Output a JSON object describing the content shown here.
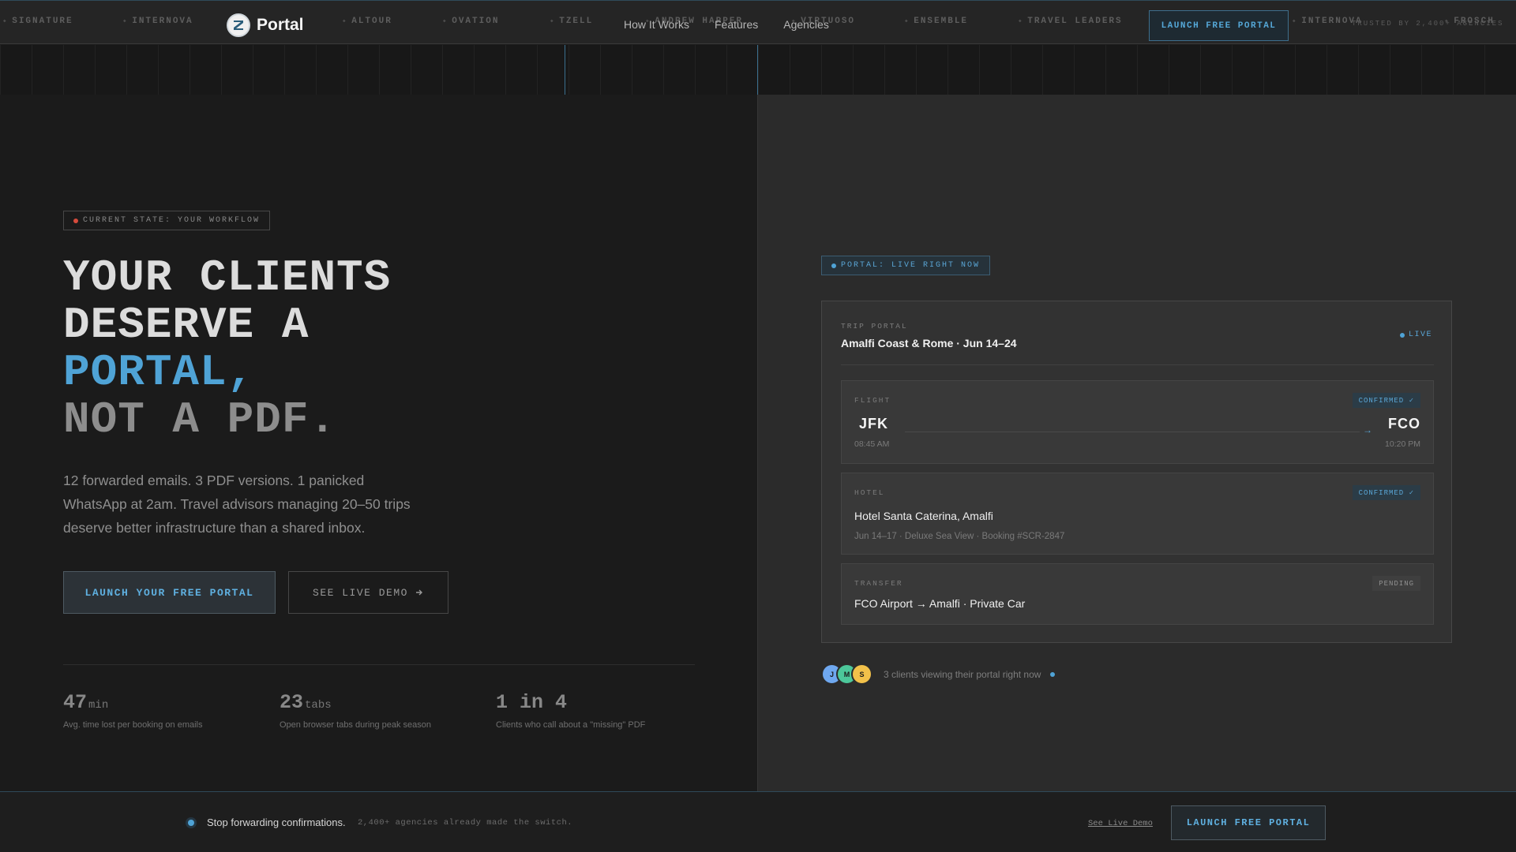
{
  "nav": {
    "ticker": [
      "SIGNATURE",
      "INTERNOVA",
      "ALTOUR",
      "OVATION",
      "TZELL",
      "ANDREW HARPER",
      "VIRTUOSO",
      "ENSEMBLE",
      "TRAVEL LEADERS",
      "INTERNOVA",
      "FROSCH"
    ],
    "brand": "Portal",
    "links": [
      "How It Works",
      "Features",
      "Agencies"
    ],
    "cta": "LAUNCH FREE PORTAL",
    "trusted": "TRUSTED BY 2,400+ AGENCIES"
  },
  "hero": {
    "state_badge": "CURRENT STATE: YOUR WORKFLOW",
    "title_line1": "YOUR CLIENTS",
    "title_line2": "DESERVE A",
    "title_line3": "PORTAL,",
    "title_line4": "NOT A PDF.",
    "subtitle": "12 forwarded emails. 3 PDF versions. 1 panicked WhatsApp at 2am. Travel advisors managing 20–50 trips deserve better infrastructure than a shared inbox.",
    "primary_cta": "LAUNCH YOUR FREE PORTAL",
    "secondary_cta": "SEE LIVE DEMO",
    "secondary_icon": "arrow-right-icon"
  },
  "stats": [
    {
      "num": "47",
      "unit": "min",
      "desc": "Avg. time lost per booking on emails"
    },
    {
      "num": "23",
      "unit": "tabs",
      "desc": "Open browser tabs during peak season"
    },
    {
      "num": "1 in 4",
      "unit": "",
      "desc": "Clients who call about a \"missing\" PDF"
    }
  ],
  "portal": {
    "badge": "PORTAL: LIVE RIGHT NOW",
    "eyebrow": "TRIP PORTAL",
    "trip_title": "Amalfi Coast & Rome · Jun 14–24",
    "live_label": "LIVE",
    "flight": {
      "label": "FLIGHT",
      "status": "CONFIRMED ✓",
      "from": "JFK",
      "to": "FCO",
      "depart": "08:45 AM",
      "arrive": "10:20 PM"
    },
    "hotel": {
      "label": "HOTEL",
      "status": "CONFIRMED ✓",
      "name": "Hotel Santa Caterina, Amalfi",
      "detail": "Jun 14–17 · Deluxe Sea View · Booking #SCR-2847"
    },
    "transfer": {
      "label": "TRANSFER",
      "status": "PENDING",
      "route": "FCO Airport → Amalfi · Private Car"
    },
    "viewers": {
      "avatars": [
        {
          "initial": "J",
          "color": "#6fa8f0"
        },
        {
          "initial": "M",
          "color": "#4cc79a"
        },
        {
          "initial": "S",
          "color": "#f2c14a"
        }
      ],
      "text": "3 clients viewing their portal right now"
    }
  },
  "bottom_bar": {
    "main": "Stop forwarding confirmations.",
    "sub": "2,400+ agencies already made the switch.",
    "link": "See Live Demo",
    "cta": "LAUNCH FREE PORTAL"
  },
  "colors": {
    "accent": "#4fa3d6",
    "alert": "#d64b3c",
    "background": "#1b1b1b",
    "panel": "#2b2b2b"
  }
}
